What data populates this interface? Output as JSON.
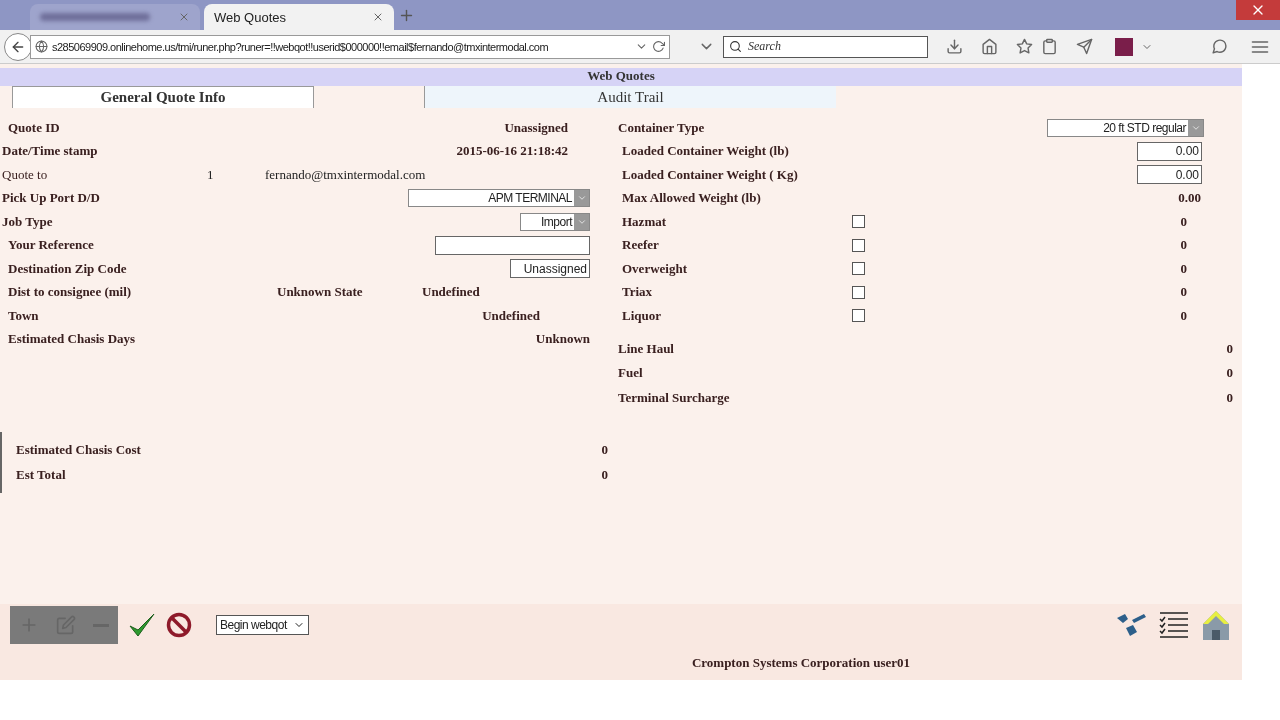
{
  "browser": {
    "tabs": [
      {
        "kind": "blurred",
        "selected": false
      },
      {
        "kind": "titled",
        "title": "Web Quotes",
        "selected": true
      }
    ],
    "url": "s285069909.onlinehome.us/tmi/runer.php?runer=!!webqot!!userid$000000!!email$fernando@tmxintermodal.com",
    "search": {
      "placeholder": "Search"
    }
  },
  "page": {
    "header": "Web Quotes",
    "section_tabs": [
      {
        "label": "General Quote Info",
        "selected": true
      },
      {
        "label": "Audit Trail",
        "selected": false
      }
    ],
    "left_rows": [
      {
        "kind": "text",
        "label": "Quote ID",
        "value": "Unassigned"
      },
      {
        "kind": "text",
        "label": "Date/Time stamp",
        "value": "2015-06-16 21:18:42"
      },
      {
        "kind": "quote_to",
        "label": "Quote to",
        "count": "1",
        "email": "fernando@tmxintermodal.com"
      },
      {
        "kind": "select",
        "label": "Pick Up Port D/D",
        "value": "APM TERMINAL"
      },
      {
        "kind": "select",
        "label": "Job Type",
        "value": "Import"
      },
      {
        "kind": "input",
        "label": "Your Reference"
      },
      {
        "kind": "input",
        "label": "Destination Zip Code",
        "value": "Unassigned"
      },
      {
        "kind": "triple",
        "label": "Dist to consignee (mil)",
        "middle": "Unknown State",
        "value": "Undefined"
      },
      {
        "kind": "town",
        "label": "Town",
        "value": "Undefined"
      },
      {
        "kind": "text",
        "label": "Estimated Chasis Days",
        "value": "Unknown"
      }
    ],
    "right_rows": [
      {
        "kind": "select",
        "label": "Container Type",
        "value": "20 ft STD regular"
      },
      {
        "kind": "input",
        "label": "Loaded Container Weight (lb)",
        "value": "0.00"
      },
      {
        "kind": "input",
        "label": "Loaded Container Weight ( Kg)",
        "value": "0.00"
      },
      {
        "kind": "text",
        "label": "Max Allowed Weight (lb)",
        "value": "0.00"
      },
      {
        "kind": "checkbox",
        "label": "Hazmat",
        "checked": false,
        "value": "0"
      },
      {
        "kind": "checkbox",
        "label": "Reefer",
        "checked": false,
        "value": "0"
      },
      {
        "kind": "checkbox",
        "label": "Overweight",
        "checked": false,
        "value": "0"
      },
      {
        "kind": "checkbox",
        "label": "Triax",
        "checked": false,
        "value": "0"
      },
      {
        "kind": "checkbox",
        "label": "Liquor",
        "checked": false,
        "value": "0"
      }
    ],
    "charges": [
      {
        "label": "Line Haul",
        "value": "0"
      },
      {
        "label": "Fuel",
        "value": "0"
      },
      {
        "label": "Terminal Surcharge",
        "value": "0"
      }
    ],
    "totals": [
      {
        "label": "Estimated Chasis Cost",
        "value": "0"
      },
      {
        "label": "Est Total",
        "value": "0"
      }
    ],
    "action_select": "Begin webqot",
    "footer": "Crompton Systems Corporation user01"
  }
}
